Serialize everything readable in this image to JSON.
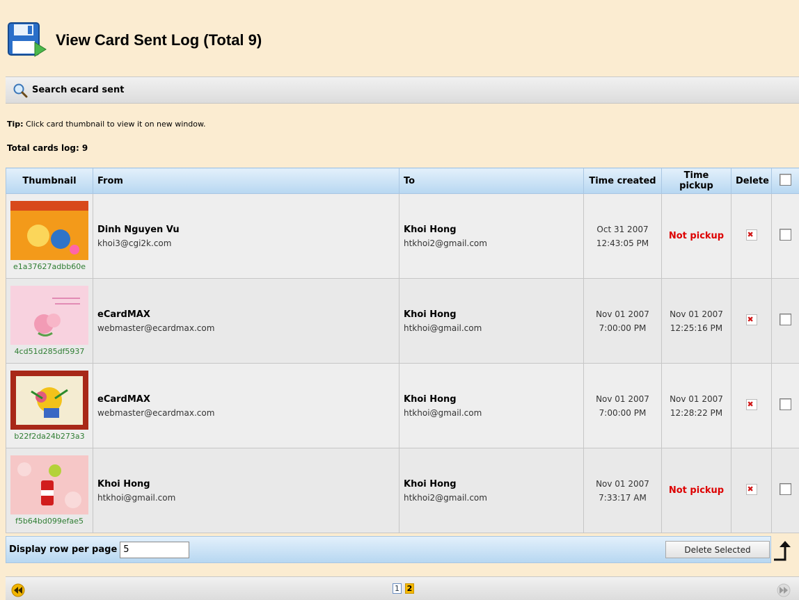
{
  "header": {
    "title": "View Card Sent Log (Total 9)"
  },
  "search": {
    "label": "Search ecard sent"
  },
  "tip": {
    "prefix": "Tip:",
    "text": " Click card thumbnail to view it on new window."
  },
  "total_label": "Total cards log: 9",
  "table": {
    "columns": [
      "Thumbnail",
      "From",
      "To",
      "Time created",
      "Time pickup",
      "Delete"
    ],
    "rows": [
      {
        "thumb_id": "e1a37627adbb60e",
        "thumb_colors": [
          "#f7a21b",
          "#e86a00"
        ],
        "from_name": "Dinh Nguyen Vu",
        "from_email": "khoi3@cgi2k.com",
        "to_name": "Khoi Hong",
        "to_email": "htkhoi2@gmail.com",
        "created_date": "Oct 31 2007",
        "created_time": "12:43:05 PM",
        "pickup_status": "Not pickup"
      },
      {
        "thumb_id": "4cd51d285df5937",
        "thumb_colors": [
          "#f8d2df",
          "#f3b3c8"
        ],
        "from_name": "eCardMAX",
        "from_email": "webmaster@ecardmax.com",
        "to_name": "Khoi Hong",
        "to_email": "htkhoi@gmail.com",
        "created_date": "Nov 01 2007",
        "created_time": "7:00:00 PM",
        "pickup_date": "Nov 01 2007",
        "pickup_time": "12:25:16 PM"
      },
      {
        "thumb_id": "b22f2da24b273a3",
        "thumb_colors": [
          "#b02a1b",
          "#f4f0e0"
        ],
        "from_name": "eCardMAX",
        "from_email": "webmaster@ecardmax.com",
        "to_name": "Khoi Hong",
        "to_email": "htkhoi@gmail.com",
        "created_date": "Nov 01 2007",
        "created_time": "7:00:00 PM",
        "pickup_date": "Nov 01 2007",
        "pickup_time": "12:28:22 PM"
      },
      {
        "thumb_id": "f5b64bd099efae5",
        "thumb_colors": [
          "#f6c7c7",
          "#e79a9a"
        ],
        "from_name": "Khoi Hong",
        "from_email": "htkhoi@gmail.com",
        "to_name": "Khoi Hong",
        "to_email": "htkhoi2@gmail.com",
        "created_date": "Nov 01 2007",
        "created_time": "7:33:17 AM",
        "pickup_status": "Not pickup"
      }
    ]
  },
  "footer": {
    "rows_label": "Display row per page",
    "rows_value": "5",
    "delete_selected": "Delete Selected"
  },
  "pager": {
    "pages": [
      "1",
      "2"
    ],
    "current": "2"
  },
  "colors": {
    "page_bg": "#fbecd1",
    "header_blue": "#b7d7f1",
    "not_pickup_red": "#dd0000",
    "thumb_id_green": "#2e7d32"
  }
}
